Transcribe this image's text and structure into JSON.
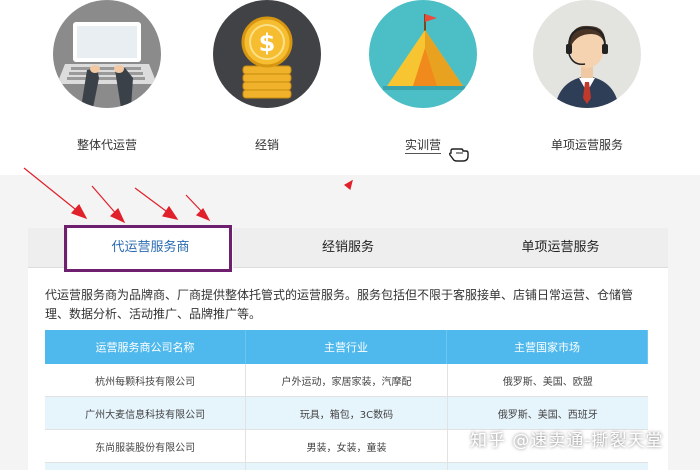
{
  "services": [
    {
      "label": "整体代运营",
      "icon": "laptop-typing-icon"
    },
    {
      "label": "经销",
      "icon": "gold-coin-icon"
    },
    {
      "label": "实训营",
      "icon": "camp-tent-icon"
    },
    {
      "label": "单项运营服务",
      "icon": "customer-service-agent-icon"
    }
  ],
  "tabs": [
    "代运营服务商",
    "经销服务",
    "单项运营服务"
  ],
  "active_tab": 0,
  "description": "代运营服务商为品牌商、厂商提供整体托管式的运营服务。服务包括但不限于客服接单、店铺日常运营、仓储管理、数据分析、活动推广、品牌推广等。",
  "table": {
    "headers": [
      "运营服务商公司名称",
      "主营行业",
      "主营国家市场"
    ],
    "rows": [
      [
        "杭州每颗科技有限公司",
        "户外运动，家居家装，汽摩配",
        "俄罗斯、美国、欧盟"
      ],
      [
        "广州大麦信息科技有限公司",
        "玩具，箱包，3C数码",
        "俄罗斯、美国、西班牙"
      ],
      [
        "东尚服装股份有限公司",
        "男装，女装，童装",
        ""
      ]
    ]
  },
  "watermark": "知乎 @速卖通-撕裂天堂",
  "colors": {
    "table_header": "#4fb9ee",
    "row_alt": "#e6f4fc",
    "highlight_box": "#6e1f6e",
    "annotation_arrow": "#e0202a",
    "active_tab_text": "#2b6bb3"
  }
}
